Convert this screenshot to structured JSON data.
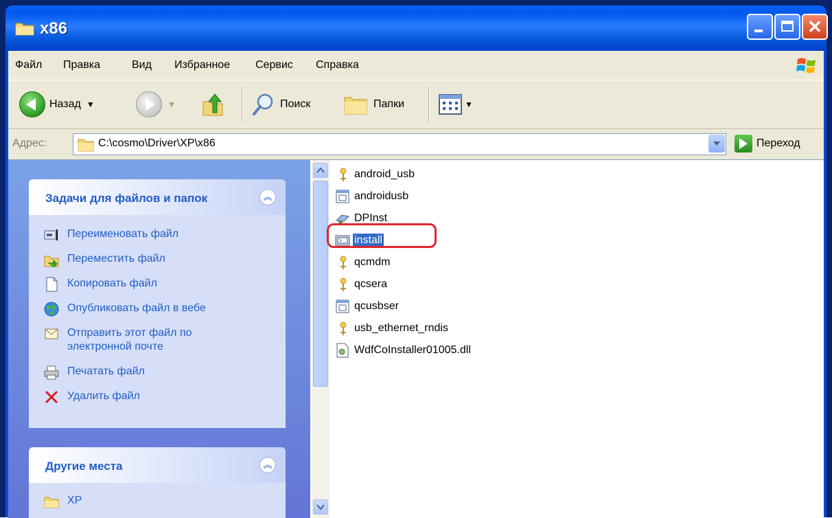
{
  "window": {
    "title": "x86"
  },
  "menu": {
    "items": [
      "Файл",
      "Правка",
      "Вид",
      "Избранное",
      "Сервис",
      "Справка"
    ]
  },
  "toolbar": {
    "back_label": "Назад",
    "search_label": "Поиск",
    "folders_label": "Папки"
  },
  "address": {
    "label": "Адрес:",
    "path": "C:\\cosmo\\Driver\\XP\\x86",
    "go_label": "Переход"
  },
  "tasks_panel": {
    "title": "Задачи для файлов и папок",
    "items": [
      {
        "label": "Переименовать файл",
        "icon": "rename-icon"
      },
      {
        "label": "Переместить файл",
        "icon": "move-icon"
      },
      {
        "label": "Копировать файл",
        "icon": "copy-icon"
      },
      {
        "label": "Опубликовать файл в вебе",
        "icon": "web-publish-icon"
      },
      {
        "label": "Отправить этот файл по электронной почте",
        "icon": "email-icon"
      },
      {
        "label": "Печатать файл",
        "icon": "print-icon"
      },
      {
        "label": "Удалить файл",
        "icon": "delete-icon"
      }
    ]
  },
  "places_panel": {
    "title": "Другие места",
    "items": [
      {
        "label": "XP",
        "icon": "folder-icon"
      }
    ]
  },
  "files": [
    {
      "name": "android_usb",
      "icon": "inf-icon"
    },
    {
      "name": "androidusb",
      "icon": "sys-icon"
    },
    {
      "name": "DPInst",
      "icon": "exe-icon"
    },
    {
      "name": "install",
      "icon": "bat-icon",
      "selected": true
    },
    {
      "name": "qcmdm",
      "icon": "inf-icon"
    },
    {
      "name": "qcsera",
      "icon": "inf-icon"
    },
    {
      "name": "qcusbser",
      "icon": "sys-icon"
    },
    {
      "name": "usb_ethernet_rndis",
      "icon": "inf-icon"
    },
    {
      "name": "WdfCoInstaller01005.dll",
      "icon": "dll-icon"
    }
  ],
  "colors": {
    "title_blue": "#0058ee",
    "selection": "#316ac5",
    "annotation_red": "#e0262b",
    "task_link": "#215dc6"
  }
}
